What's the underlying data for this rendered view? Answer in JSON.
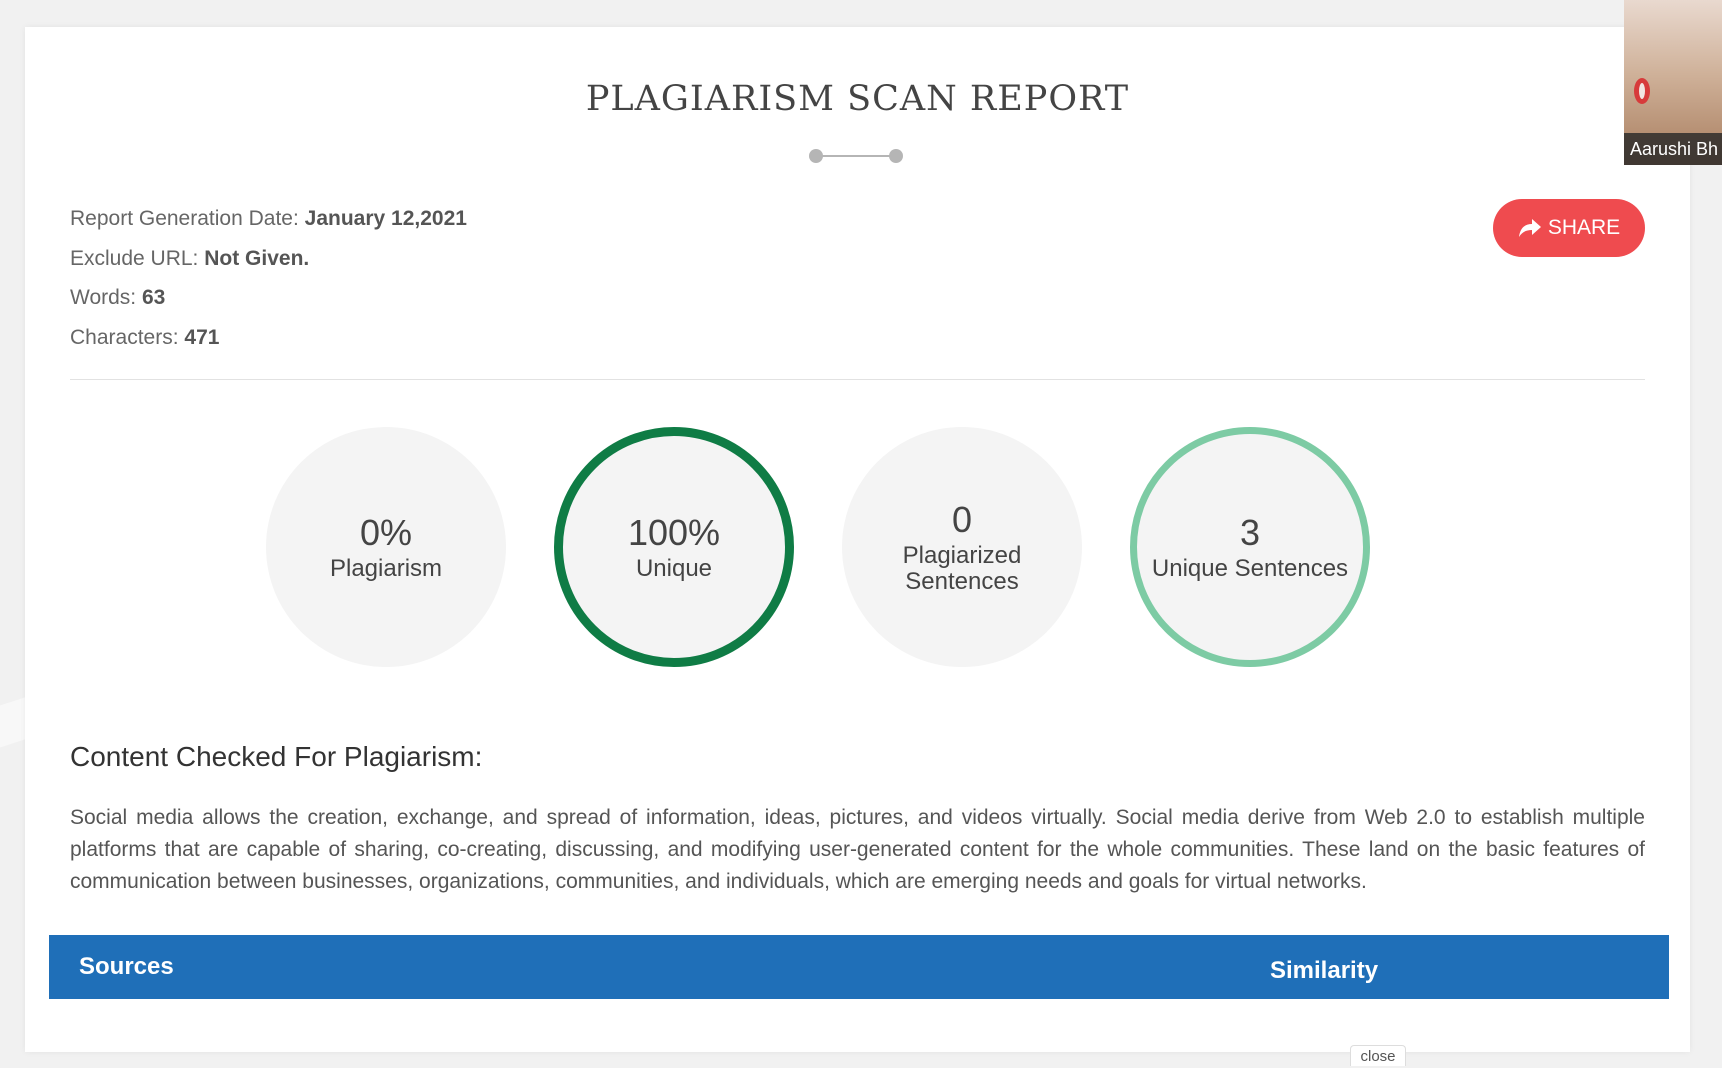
{
  "report": {
    "title": "PLAGIARISM SCAN REPORT",
    "meta": [
      {
        "label": "Report Generation Date:",
        "value": "January 12,2021"
      },
      {
        "label": "Exclude URL:",
        "value": "Not Given."
      },
      {
        "label": "Words:",
        "value": "63"
      },
      {
        "label": "Characters:",
        "value": "471"
      }
    ],
    "share_label": "SHARE"
  },
  "stats": [
    {
      "number": "0%",
      "label": "Plagiarism",
      "ring_color": ""
    },
    {
      "number": "100%",
      "label": "Unique",
      "ring_color": "#0f7c45"
    },
    {
      "number": "0",
      "label": "Plagiarized Sentences",
      "ring_color": ""
    },
    {
      "number": "3",
      "label": "Unique Sentences",
      "ring_color": "#7dcba4"
    }
  ],
  "content": {
    "heading": "Content Checked For Plagiarism:",
    "text": "Social media allows the creation, exchange, and spread of information, ideas, pictures, and videos virtually. Social media derive from Web 2.0 to establish multiple platforms that are capable of sharing, co-creating, discussing, and modifying user-generated content for the whole communities. These land on the basic features of communication between businesses, organizations, communities, and individuals, which are emerging needs and goals for virtual networks."
  },
  "sources_table": {
    "headers": [
      "Sources",
      "Similarity"
    ]
  },
  "video_tile": {
    "participant_name": "Aarushi Bh"
  },
  "close_label": "close",
  "icons": {
    "share": "share-arrow-icon",
    "title_ornament": "dot-line-dot-icon"
  },
  "colors": {
    "share_button": "#ef4b4f",
    "sources_bar": "#1f6fb8",
    "unique_ring": "#0f7c45",
    "unique_sentences_ring": "#7dcba4"
  }
}
